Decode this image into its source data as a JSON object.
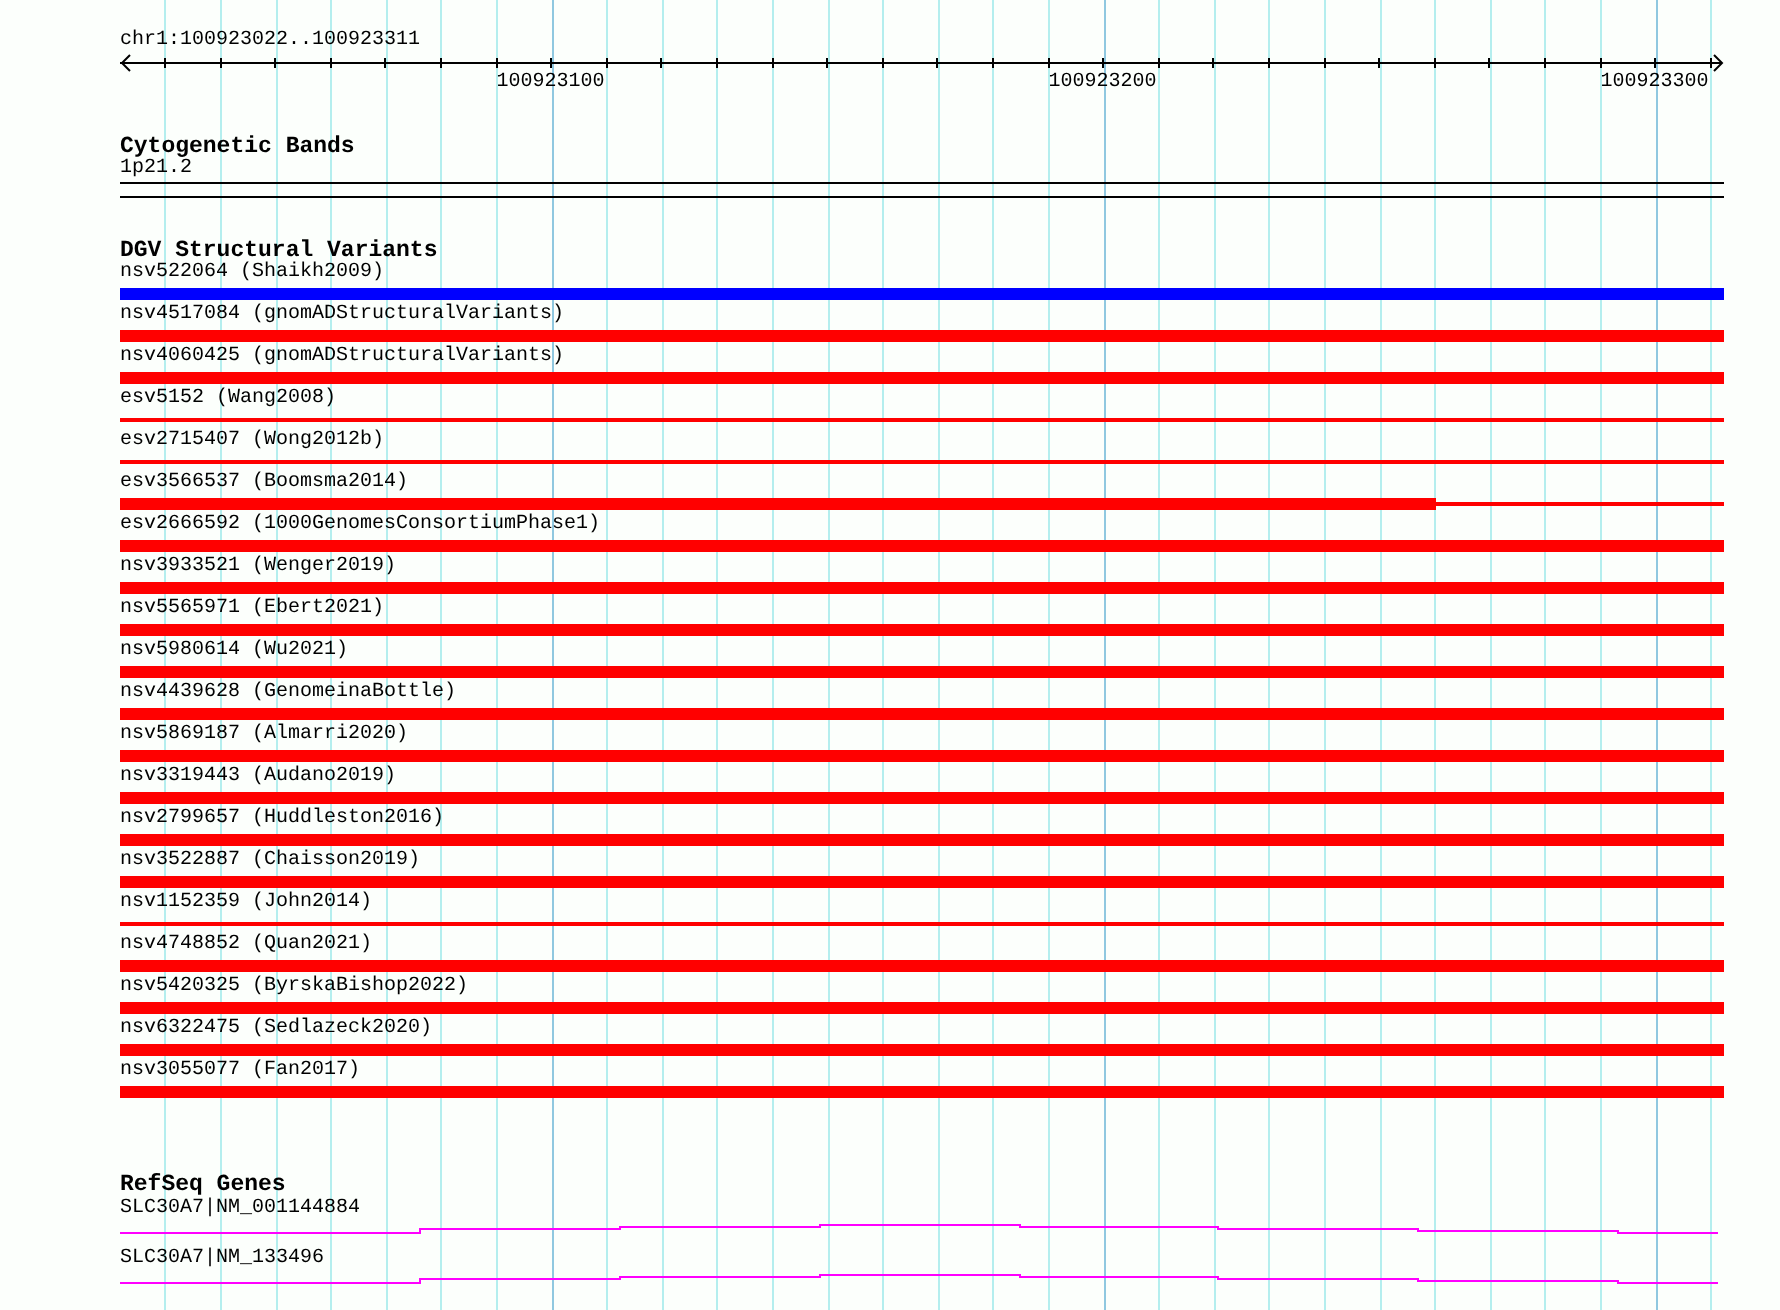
{
  "ruler": {
    "region": "chr1:100923022..100923311",
    "tick_labels": [
      "100923100",
      "100923200",
      "100923300"
    ]
  },
  "cytogenetic_bands": {
    "title": "Cytogenetic Bands",
    "band": "1p21.2"
  },
  "dgv": {
    "title": "DGV Structural Variants",
    "variants": [
      {
        "label": "nsv522064 (Shaikh2009)",
        "kind": "thick",
        "color": "#0000ff"
      },
      {
        "label": "nsv4517084 (gnomADStructuralVariants)",
        "kind": "thick",
        "color": "#ff0000"
      },
      {
        "label": "nsv4060425 (gnomADStructuralVariants)",
        "kind": "thick",
        "color": "#ff0000"
      },
      {
        "label": "esv5152 (Wang2008)",
        "kind": "thin",
        "color": "#ff0000"
      },
      {
        "label": "esv2715407 (Wong2012b)",
        "kind": "thin",
        "color": "#ff0000"
      },
      {
        "label": "esv3566537 (Boomsma2014)",
        "kind": "partial",
        "color": "#ff0000",
        "level": 0.82
      },
      {
        "label": "esv2666592 (1000GenomesConsortiumPhase1)",
        "kind": "thick",
        "color": "#ff0000"
      },
      {
        "label": "nsv3933521 (Wenger2019)",
        "kind": "thick",
        "color": "#ff0000"
      },
      {
        "label": "nsv5565971 (Ebert2021)",
        "kind": "thick",
        "color": "#ff0000"
      },
      {
        "label": "nsv5980614 (Wu2021)",
        "kind": "thick",
        "color": "#ff0000"
      },
      {
        "label": "nsv4439628 (GenomeinaBottle)",
        "kind": "thick",
        "color": "#ff0000"
      },
      {
        "label": "nsv5869187 (Almarri2020)",
        "kind": "thick",
        "color": "#ff0000"
      },
      {
        "label": "nsv3319443 (Audano2019)",
        "kind": "thick",
        "color": "#ff0000"
      },
      {
        "label": "nsv2799657 (Huddleston2016)",
        "kind": "thick",
        "color": "#ff0000"
      },
      {
        "label": "nsv3522887 (Chaisson2019)",
        "kind": "thick",
        "color": "#ff0000"
      },
      {
        "label": "nsv1152359 (John2014)",
        "kind": "thin",
        "color": "#ff0000"
      },
      {
        "label": "nsv4748852 (Quan2021)",
        "kind": "thick",
        "color": "#ff0000"
      },
      {
        "label": "nsv5420325 (ByrskaBishop2022)",
        "kind": "thick",
        "color": "#ff0000"
      },
      {
        "label": "nsv6322475 (Sedlazeck2020)",
        "kind": "thick",
        "color": "#ff0000"
      },
      {
        "label": "nsv3055077 (Fan2017)",
        "kind": "thick",
        "color": "#ff0000"
      }
    ]
  },
  "refseq": {
    "title": "RefSeq Genes",
    "genes": [
      {
        "label": "SLC30A7|NM_001144884"
      },
      {
        "label": "SLC30A7|NM_133496"
      }
    ]
  }
}
